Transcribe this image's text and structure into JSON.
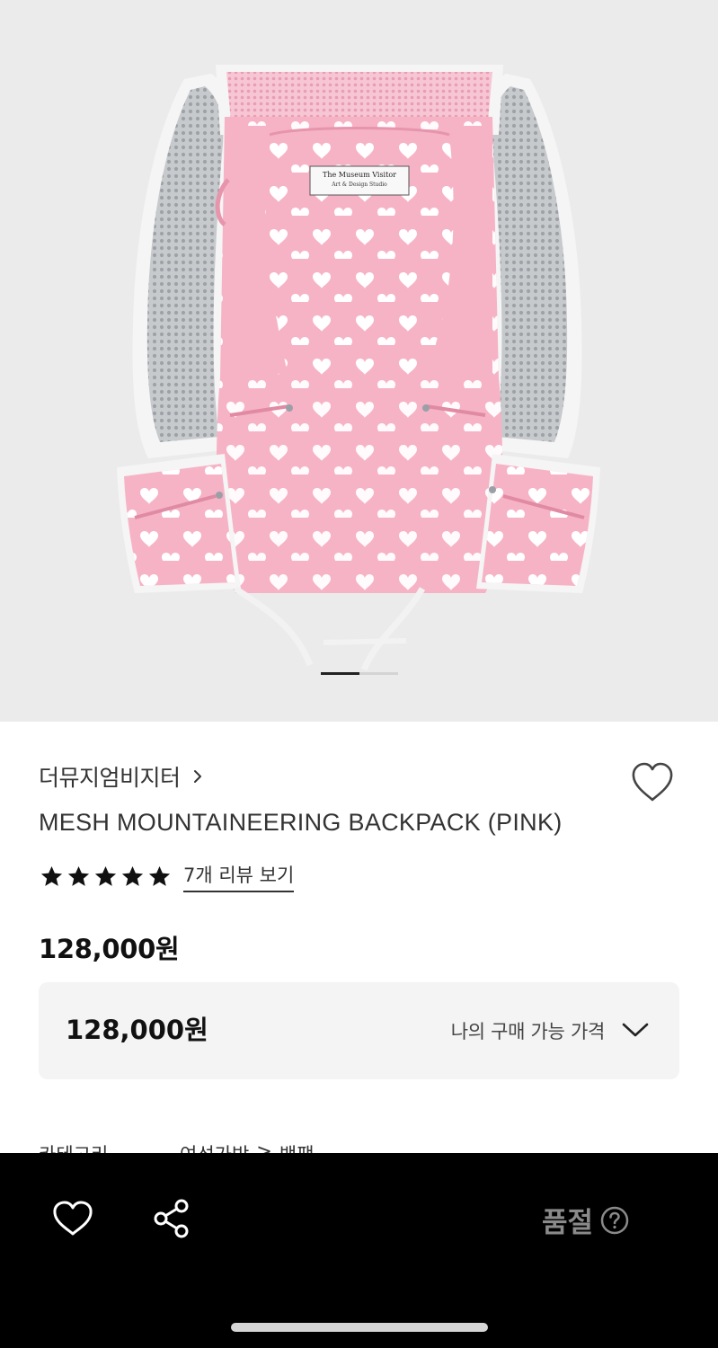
{
  "product": {
    "image": {
      "description_icon": "pink-heart-mesh-backpack-image",
      "tag_line1": "The Museum Visitor",
      "tag_line2": "Art & Design Studio",
      "colors": {
        "pink": "#f6b3c6",
        "heart": "#ffffff",
        "mesh": "#b9bcc0",
        "trim": "#f4f4f4",
        "background": "#ebebeb"
      }
    },
    "carousel": {
      "current": 1,
      "total": 2
    },
    "brand": "더뮤지엄비지터",
    "name": "MESH MOUNTAINEERING BACKPACK (PINK)",
    "rating": {
      "stars": 5,
      "max": 5,
      "review_link": "7개 리뷰 보기"
    },
    "price": "128,000원"
  },
  "price_box": {
    "price": "128,000원",
    "label": "나의 구매 가능 가격"
  },
  "category": {
    "label": "카테고리",
    "path": [
      "여성가방",
      ">",
      "백팩"
    ]
  },
  "bottom_bar": {
    "wish_icon": "heart-outline-icon",
    "share_icon": "share-icon",
    "status": "품절",
    "help_icon": "question-circle-icon"
  }
}
